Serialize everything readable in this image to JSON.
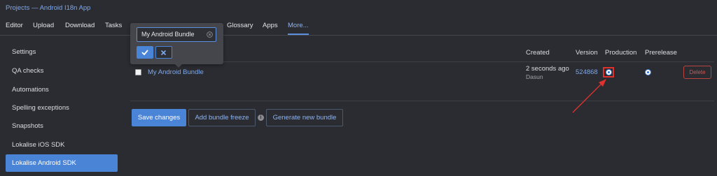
{
  "breadcrumb": "Projects — Android I18n App",
  "nav": {
    "tabs": [
      "Editor",
      "Upload",
      "Download",
      "Tasks",
      "Glossary",
      "Apps",
      "More..."
    ]
  },
  "sidebar": {
    "items": [
      "Settings",
      "QA checks",
      "Automations",
      "Spelling exceptions",
      "Snapshots",
      "Lokalise iOS SDK",
      "Lokalise Android SDK"
    ]
  },
  "table": {
    "headers": [
      "Created",
      "Version",
      "Production",
      "Prerelease"
    ],
    "row": {
      "name": "My Android Bundle",
      "created": "2 seconds ago",
      "author": "Dasun",
      "version": "524868",
      "production_selected": true,
      "prerelease_selected": true,
      "delete_label": "Delete"
    }
  },
  "actions": {
    "save": "Save changes",
    "freeze": "Add bundle freeze",
    "generate": "Generate new bundle"
  },
  "popover": {
    "input_value": "My Android Bundle"
  },
  "colors": {
    "accent": "#4a84d7",
    "link": "#7fa8e8",
    "annotation": "#e0312c",
    "danger": "#d9534f"
  },
  "icons": {
    "confirm": "check-icon",
    "cancel": "close-icon",
    "clear": "clear-circle-icon",
    "info": "info-icon"
  }
}
